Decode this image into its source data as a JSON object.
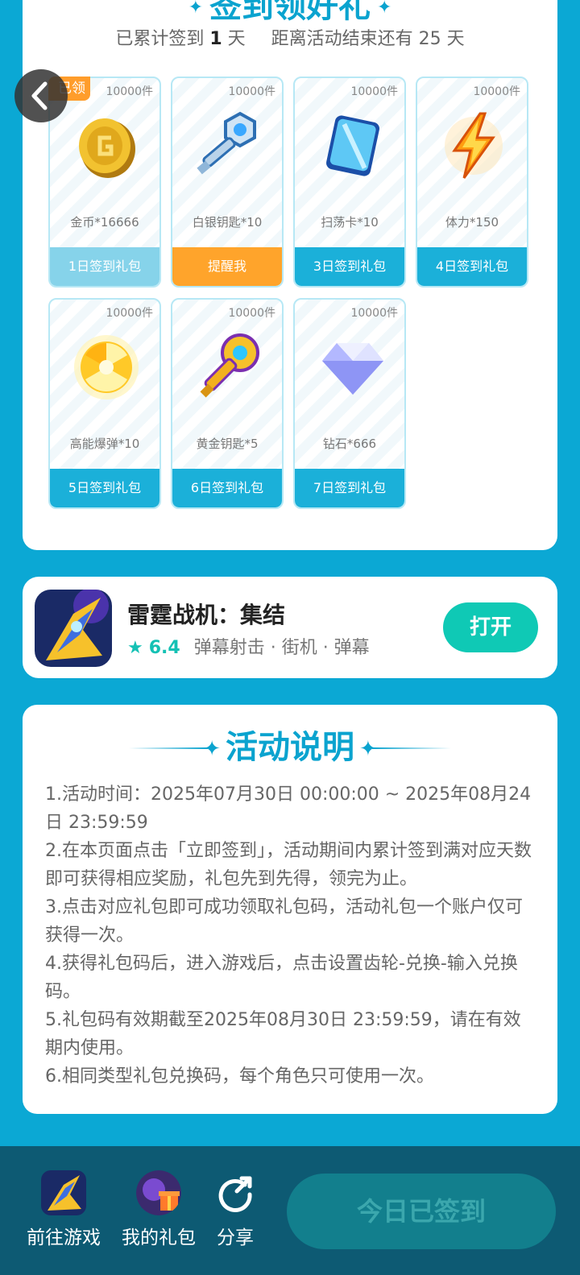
{
  "signin": {
    "title": "签到领好礼",
    "stats_prefix": "已累计签到",
    "days": "1",
    "days_unit": "天",
    "remaining_prefix": "距离活动结束还有",
    "remaining_days": "25",
    "remaining_unit": "天",
    "claimed_badge": "已领",
    "gifts": [
      {
        "qty": "10000件",
        "name": "金币*16666",
        "button": "1日签到礼包",
        "state": "claimed"
      },
      {
        "qty": "10000件",
        "name": "白银钥匙*10",
        "button": "提醒我",
        "state": "remind"
      },
      {
        "qty": "10000件",
        "name": "扫荡卡*10",
        "button": "3日签到礼包",
        "state": "normal"
      },
      {
        "qty": "10000件",
        "name": "体力*150",
        "button": "4日签到礼包",
        "state": "normal"
      },
      {
        "qty": "10000件",
        "name": "高能爆弹*10",
        "button": "5日签到礼包",
        "state": "normal"
      },
      {
        "qty": "10000件",
        "name": "黄金钥匙*5",
        "button": "6日签到礼包",
        "state": "normal"
      },
      {
        "qty": "10000件",
        "name": "钻石*666",
        "button": "7日签到礼包",
        "state": "normal"
      }
    ]
  },
  "game": {
    "name": "雷霆战机：集结",
    "rating": "6.4",
    "tags": "弹幕射击 · 街机 · 弹幕",
    "open_label": "打开"
  },
  "rules": {
    "title": "活动说明",
    "items": [
      "1.活动时间：2025年07月30日 00:00:00 ~ 2025年08月24日 23:59:59",
      "2.在本页面点击「立即签到」，活动期间内累计签到满对应天数即可获得相应奖励，礼包先到先得，领完为止。",
      "3.点击对应礼包即可成功领取礼包码，活动礼包一个账户仅可获得一次。",
      "4.获得礼包码后，进入游戏后，点击设置齿轮-兑换-输入兑换码。",
      "5.礼包码有效期截至2025年08月30日 23:59:59，请在有效期内使用。",
      "6.相同类型礼包兑换码，每个角色只可使用一次。"
    ]
  },
  "bottom": {
    "go_game": "前往游戏",
    "my_gifts": "我的礼包",
    "share": "分享",
    "signed_label": "今日已签到"
  },
  "colors": {
    "primary": "#0ba8d4",
    "button_blue": "#1bb0d9",
    "remind_orange": "#ffa42b",
    "teal": "#0fc9b5",
    "bottom_bar": "#0d5a73"
  }
}
